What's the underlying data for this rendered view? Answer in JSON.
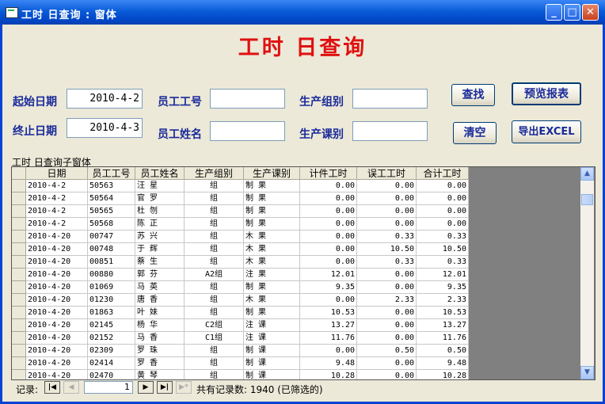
{
  "window": {
    "title": "工时 日查询 : 窗体",
    "min": "_",
    "max": "□",
    "close": "✕"
  },
  "form": {
    "title": "工时  日查询",
    "start_label": "起始日期",
    "start_value": "2010-4-2",
    "end_label": "终止日期",
    "end_value": "2010-4-3",
    "emp_id_label": "员工工号",
    "emp_id_value": "",
    "emp_name_label": "员工姓名",
    "emp_name_value": "",
    "group_label": "生产组别",
    "group_value": "",
    "section_label": "生产课别",
    "section_value": "",
    "buttons": {
      "search": "查找",
      "preview": "预览报表",
      "clear": "清空",
      "export": "导出EXCEL"
    }
  },
  "subform": {
    "label": "工时  日查询子窗体",
    "columns": [
      "日期",
      "员工工号",
      "员工姓名",
      "生产组别",
      "生产课别",
      "计件工时",
      "误工工时",
      "合计工时"
    ],
    "rows": [
      [
        "2010-4-2",
        "50563",
        "汪  星",
        "组",
        "制  果",
        "0.00",
        "0.00",
        "0.00"
      ],
      [
        "2010-4-2",
        "50564",
        "官  罗",
        "组",
        "制  果",
        "0.00",
        "0.00",
        "0.00"
      ],
      [
        "2010-4-2",
        "50565",
        "杜  刎",
        "组",
        "制  果",
        "0.00",
        "0.00",
        "0.00"
      ],
      [
        "2010-4-2",
        "50568",
        "陈  正",
        "组",
        "制  果",
        "0.00",
        "0.00",
        "0.00"
      ],
      [
        "2010-4-20",
        "00747",
        "苏  兴",
        "组",
        "木  果",
        "0.00",
        "0.33",
        "0.33"
      ],
      [
        "2010-4-20",
        "00748",
        "于  辉",
        "组",
        "木  果",
        "0.00",
        "10.50",
        "10.50"
      ],
      [
        "2010-4-20",
        "00851",
        "蔡  生",
        "组",
        "木  果",
        "0.00",
        "0.33",
        "0.33"
      ],
      [
        "2010-4-20",
        "00880",
        "郭  芬",
        "A2组",
        "注  果",
        "12.01",
        "0.00",
        "12.01"
      ],
      [
        "2010-4-20",
        "01069",
        "马  英",
        "组",
        "制  果",
        "9.35",
        "0.00",
        "9.35"
      ],
      [
        "2010-4-20",
        "01230",
        "唐  香",
        "组",
        "木  果",
        "0.00",
        "2.33",
        "2.33"
      ],
      [
        "2010-4-20",
        "01863",
        "叶  妹",
        "组",
        "制  果",
        "10.53",
        "0.00",
        "10.53"
      ],
      [
        "2010-4-20",
        "02145",
        "杨  华",
        "C2组",
        "注  课",
        "13.27",
        "0.00",
        "13.27"
      ],
      [
        "2010-4-20",
        "02152",
        "马  香",
        "C1组",
        "注  课",
        "11.76",
        "0.00",
        "11.76"
      ],
      [
        "2010-4-20",
        "02309",
        "罗  珠",
        "组",
        "制  课",
        "0.00",
        "0.50",
        "0.50"
      ],
      [
        "2010-4-20",
        "02414",
        "罗  香",
        "组",
        "制  课",
        "9.48",
        "0.00",
        "9.48"
      ],
      [
        "2010-4-20",
        "02470",
        "黄  琴",
        "组",
        "制  课",
        "10.28",
        "0.00",
        "10.28"
      ]
    ]
  },
  "nav": {
    "label": "记录:",
    "current": "1",
    "total_text": "共有记录数: 1940 (已筛选的)"
  }
}
